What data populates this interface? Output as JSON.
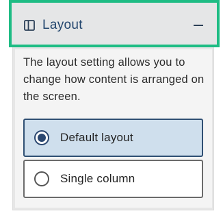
{
  "panel": {
    "title": "Layout",
    "title_icon": "columns-layout-icon",
    "toggle_icon": "minus-icon",
    "description": "The layout setting allows you to change how content is arranged on the screen.",
    "options": [
      {
        "label": "Default layout",
        "selected": true
      },
      {
        "label": "Single column",
        "selected": false
      }
    ]
  },
  "colors": {
    "focus_ring": "#1ebc84",
    "title_text": "#23466e",
    "selected_bg": "#cfdfed",
    "selected_border": "#2f4f73"
  }
}
